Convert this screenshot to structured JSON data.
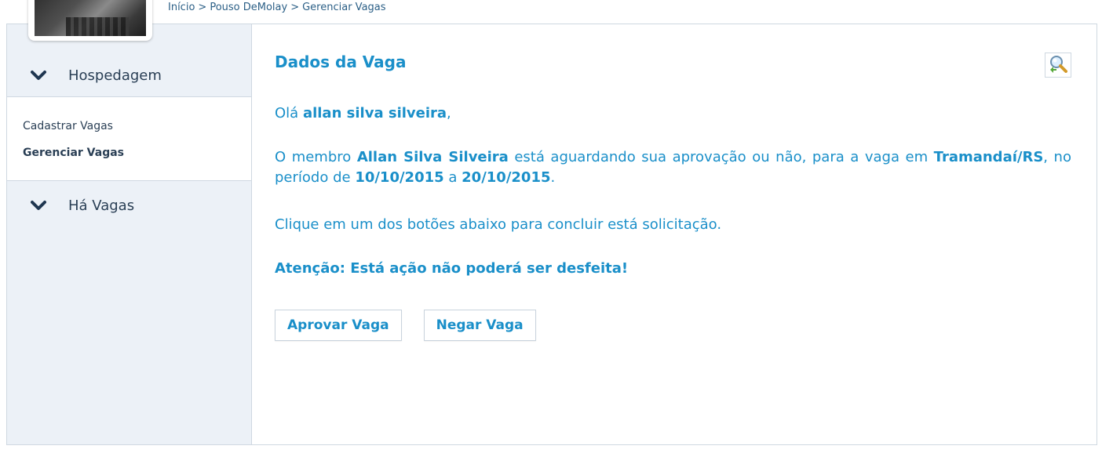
{
  "breadcrumb": {
    "items": [
      "Início",
      "Pouso DeMolay",
      "Gerenciar Vagas"
    ],
    "separator": ">"
  },
  "sidebar": {
    "sections": [
      {
        "label": "Hospedagem",
        "icon": "chevron-down-icon",
        "items": [
          {
            "label": "Cadastrar Vagas",
            "active": false
          },
          {
            "label": "Gerenciar Vagas",
            "active": true
          }
        ]
      },
      {
        "label": "Há Vagas",
        "icon": "chevron-down-icon",
        "items": []
      }
    ]
  },
  "main": {
    "title": "Dados da Vaga",
    "search_icon": "magnifier-icon",
    "greeting": {
      "prefix": "Olá",
      "user": "allan silva silveira",
      "suffix": ","
    },
    "message": {
      "t1": "O membro",
      "member": "Allan Silva Silveira",
      "t2": "está aguardando sua aprovação ou não, para a vaga em",
      "place": "Tramandaí/RS",
      "t3": ", no período de",
      "date_from": "10/10/2015",
      "t4": "a",
      "date_to": "20/10/2015",
      "t5": "."
    },
    "instruction": "Clique em um dos botões abaixo para concluir está solicitação.",
    "warning": "Atenção: Está ação não poderá ser desfeita!",
    "buttons": {
      "approve": "Aprovar Vaga",
      "deny": "Negar Vaga"
    }
  },
  "colors": {
    "accent": "#1a8fc9",
    "sidebar_bg": "#ecf1f7",
    "border": "#cfd8e1",
    "nav_text": "#2a3f55"
  }
}
